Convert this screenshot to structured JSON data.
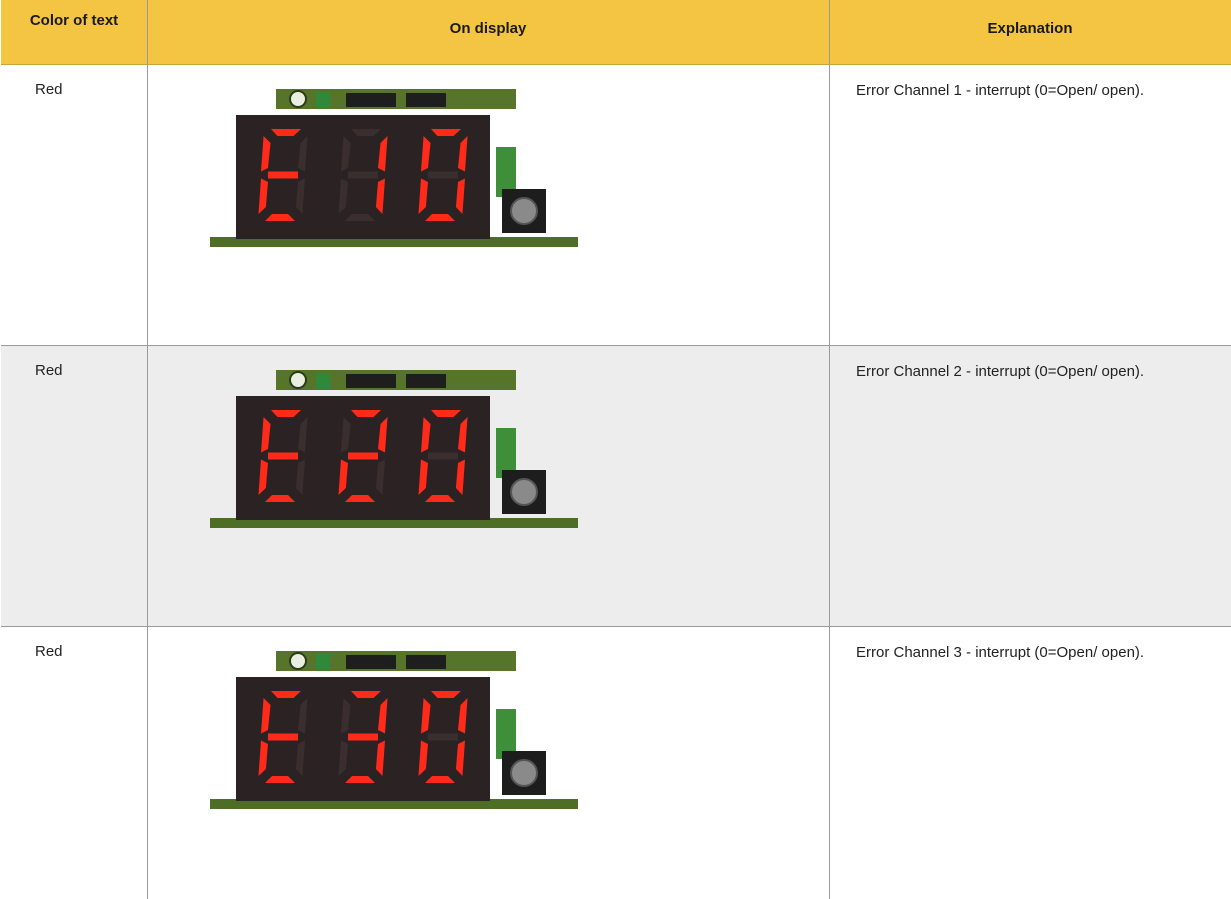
{
  "header": {
    "color_label": "Color of text",
    "display_label": "On display",
    "explanation_label": "Explanation"
  },
  "rows": [
    {
      "color": "Red",
      "code": "E10",
      "explanation": "Error Channel 1 - interrupt (0=Open/ open)."
    },
    {
      "color": "Red",
      "code": "E20",
      "explanation": "Error Channel 2 - interrupt (0=Open/ open)."
    },
    {
      "color": "Red",
      "code": "E30",
      "explanation": "Error Channel 3 - interrupt (0=Open/ open)."
    }
  ],
  "colors": {
    "header_bg": "#f4c542",
    "alt_row_bg": "#ededed",
    "segment_on": "#ff2a1a",
    "display_bg": "#2b2323",
    "pcb": "#5b7a2a"
  }
}
